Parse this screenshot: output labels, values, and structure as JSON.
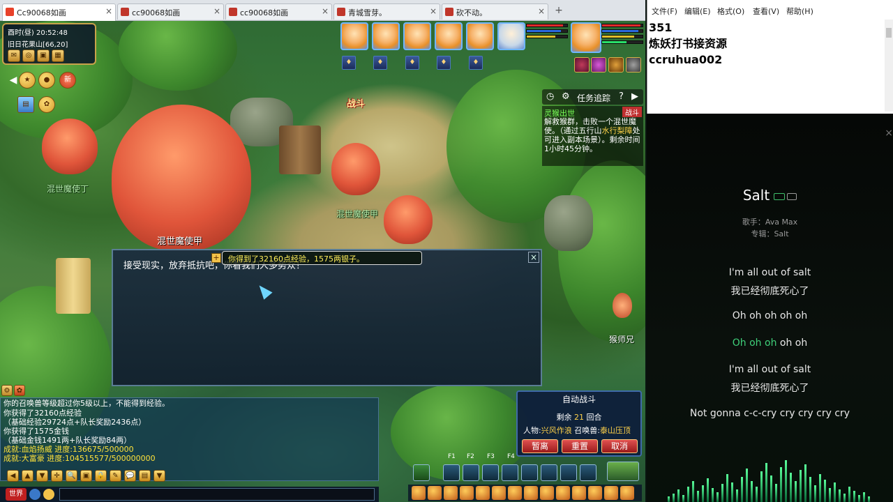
{
  "browser": {
    "tabs": [
      {
        "label": "Cc90068如画",
        "active": true,
        "color": "#e8412a"
      },
      {
        "label": "cc90068如画",
        "active": false,
        "color": "#c0362a"
      },
      {
        "label": "cc90068如画",
        "active": false,
        "color": "#c0362a"
      },
      {
        "label": "青城雪芽。",
        "active": false,
        "color": "#c0362a"
      },
      {
        "label": "砍不动。",
        "active": false,
        "color": "#c0362a"
      }
    ],
    "new_tab_symbol": "+",
    "close_symbol": "×"
  },
  "game": {
    "status": {
      "time": "酉时(昼)  20:52:48",
      "location": "旧日花果山[66,20]",
      "icons": [
        "mail-icon",
        "map-icon",
        "bag-icon",
        "calendar-icon"
      ]
    },
    "left_icons": [
      "activity-icon",
      "reward-icon",
      "new-icon",
      "shop-icon",
      "pet-icon"
    ],
    "left_new_label": "新",
    "npc_labels": {
      "monster_left": "混世魔使丁",
      "monster_center": "混世魔使甲",
      "monster_right": "混世魔使甲",
      "helper": "猴师兄"
    },
    "battle_flag": "战斗",
    "quest": {
      "header": "任务追踪",
      "title": "灵猴出世",
      "tag": "战斗",
      "text_before": "解救猴群，击败一个混世魔使。（通过五行山",
      "highlight": "水行梨障",
      "text_after": "处可进入副本场景）。剩余时间1小时45分钟。"
    },
    "dialog": {
      "text": "接受现实，放弃抵抗吧，你看我们人多势众！",
      "close": "×"
    },
    "toast": {
      "text": "你得到了32160点经验，1575两银子。",
      "plus": "+"
    },
    "chat": {
      "lines": [
        {
          "text": "你的召唤兽等级超过你5级以上，不能得到经验。",
          "color": "#ffffff"
        },
        {
          "text": "你获得了32160点经验",
          "color": "#ffffff"
        },
        {
          "text": "（基础经验29724点+队长奖励2436点）",
          "color": "#ffffff"
        },
        {
          "text": "你获得了1575金钱",
          "color": "#ffffff"
        },
        {
          "text": "（基础金钱1491两+队长奖励84两）",
          "color": "#ffffff"
        },
        {
          "text": "成就:血焰扬威   进度:136675/500000",
          "color": "#ffe23a"
        },
        {
          "text": "成就:大富豪   进度:104515577/500000000",
          "color": "#ffe23a"
        }
      ],
      "channel": "世界",
      "tools": [
        "◀",
        "▲",
        "▼",
        "✛",
        "🔍",
        "▣",
        "🔒",
        "✎",
        "💬",
        "▤",
        "▼"
      ]
    },
    "auto_battle": {
      "title": "自动战斗",
      "remain_label": "剩余",
      "remain_value": "21",
      "remain_unit": "回合",
      "char_label": "人物:",
      "char_value": "兴风作浪",
      "pet_label": "召唤兽:",
      "pet_value": "泰山压顶",
      "buttons": [
        "暂离",
        "重置",
        "取消"
      ]
    },
    "fkeys": [
      "F1",
      "F2",
      "F3",
      "F4"
    ]
  },
  "notepad": {
    "menu": [
      "文件(F)",
      "编辑(E)",
      "格式(O)",
      "查看(V)",
      "帮助(H)"
    ],
    "lines": [
      "351",
      "炼妖打书接资源",
      "ccruhua002"
    ]
  },
  "music": {
    "title": "Salt",
    "singer_label": "歌手：",
    "singer": "Ava Max",
    "album_label": "专辑：",
    "album": "Salt",
    "lyrics": [
      {
        "text": "I'm all out of salt",
        "state": "normal"
      },
      {
        "text": "我已经彻底死心了",
        "state": "normal"
      },
      {
        "text": "Oh oh oh oh oh",
        "state": "normal"
      },
      {
        "text_hl": "Oh oh oh ",
        "text_rest": "oh oh",
        "state": "partial"
      },
      {
        "text": "I'm all out of salt",
        "state": "normal"
      },
      {
        "text": "我已经彻底死心了",
        "state": "normal"
      },
      {
        "text": "Not gonna c-c-cry cry cry cry cry",
        "state": "normal"
      }
    ],
    "accent_color": "#3fd07a"
  }
}
